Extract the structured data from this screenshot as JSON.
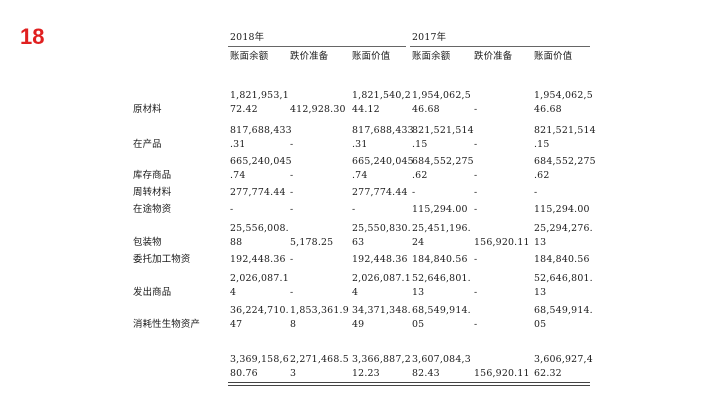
{
  "slide_number": "18",
  "table": {
    "years": [
      "2018年",
      "2017年"
    ],
    "columns": [
      "账面余额",
      "跌价准备",
      "账面价值",
      "账面余额",
      "跌价准备",
      "账面价值"
    ],
    "rows": [
      {
        "label": "原材料",
        "cells": [
          [
            "1,821,953,1",
            "72.42"
          ],
          [
            "412,928.30"
          ],
          [
            "1,821,540,2",
            "44.12"
          ],
          [
            "1,954,062,5",
            "46.68"
          ],
          [
            "-"
          ],
          [
            "1,954,062,5",
            "46.68"
          ]
        ]
      },
      {
        "label": "在产品",
        "cells": [
          [
            "817,688,433",
            ".31"
          ],
          [
            "-"
          ],
          [
            "817,688,433",
            ".31"
          ],
          [
            "821,521,514",
            ".15"
          ],
          [
            "-"
          ],
          [
            "821,521,514",
            ".15"
          ]
        ]
      },
      {
        "label": "库存商品",
        "cells": [
          [
            "665,240,045",
            ".74"
          ],
          [
            "-"
          ],
          [
            "665,240,045",
            ".74"
          ],
          [
            "684,552,275",
            ".62"
          ],
          [
            "-"
          ],
          [
            "684,552,275",
            ".62"
          ]
        ]
      },
      {
        "label": "周转材料",
        "cells": [
          [
            "277,774.44"
          ],
          [
            "-"
          ],
          [
            "277,774.44"
          ],
          [
            "-"
          ],
          [
            "-"
          ],
          [
            "-"
          ]
        ]
      },
      {
        "label": "在途物资",
        "cells": [
          [
            "-"
          ],
          [
            "-"
          ],
          [
            "-"
          ],
          [
            "115,294.00"
          ],
          [
            "-"
          ],
          [
            "115,294.00"
          ]
        ]
      },
      {
        "label": "包装物",
        "cells": [
          [
            "25,556,008.",
            "88"
          ],
          [
            "5,178.25"
          ],
          [
            "25,550,830.",
            "63"
          ],
          [
            "25,451,196.",
            "24"
          ],
          [
            "156,920.11"
          ],
          [
            "25,294,276.",
            "13"
          ]
        ]
      },
      {
        "label": "委托加工物资",
        "cells": [
          [
            "192,448.36"
          ],
          [
            "-"
          ],
          [
            "192,448.36"
          ],
          [
            "184,840.56"
          ],
          [
            "-"
          ],
          [
            "184,840.56"
          ]
        ]
      },
      {
        "label": "发出商品",
        "cells": [
          [
            "2,026,087.1",
            "4"
          ],
          [
            "-"
          ],
          [
            "2,026,087.1",
            "4"
          ],
          [
            "52,646,801.",
            "13"
          ],
          [
            "-"
          ],
          [
            "52,646,801.",
            "13"
          ]
        ]
      },
      {
        "label": "消耗性生物资产",
        "cells": [
          [
            "36,224,710.",
            "47"
          ],
          [
            "1,853,361.9",
            "8"
          ],
          [
            "34,371,348.",
            "49"
          ],
          [
            "68,549,914.",
            "05"
          ],
          [
            "-"
          ],
          [
            "68,549,914.",
            "05"
          ]
        ]
      },
      {
        "label": "",
        "cells": [
          [
            "3,369,158,6",
            "80.76"
          ],
          [
            "2,271,468.5",
            "3"
          ],
          [
            "3,366,887,2",
            "12.23"
          ],
          [
            "3,607,084,3",
            "82.43"
          ],
          [
            "156,920.11"
          ],
          [
            "3,606,927,4",
            "62.32"
          ]
        ]
      }
    ]
  }
}
